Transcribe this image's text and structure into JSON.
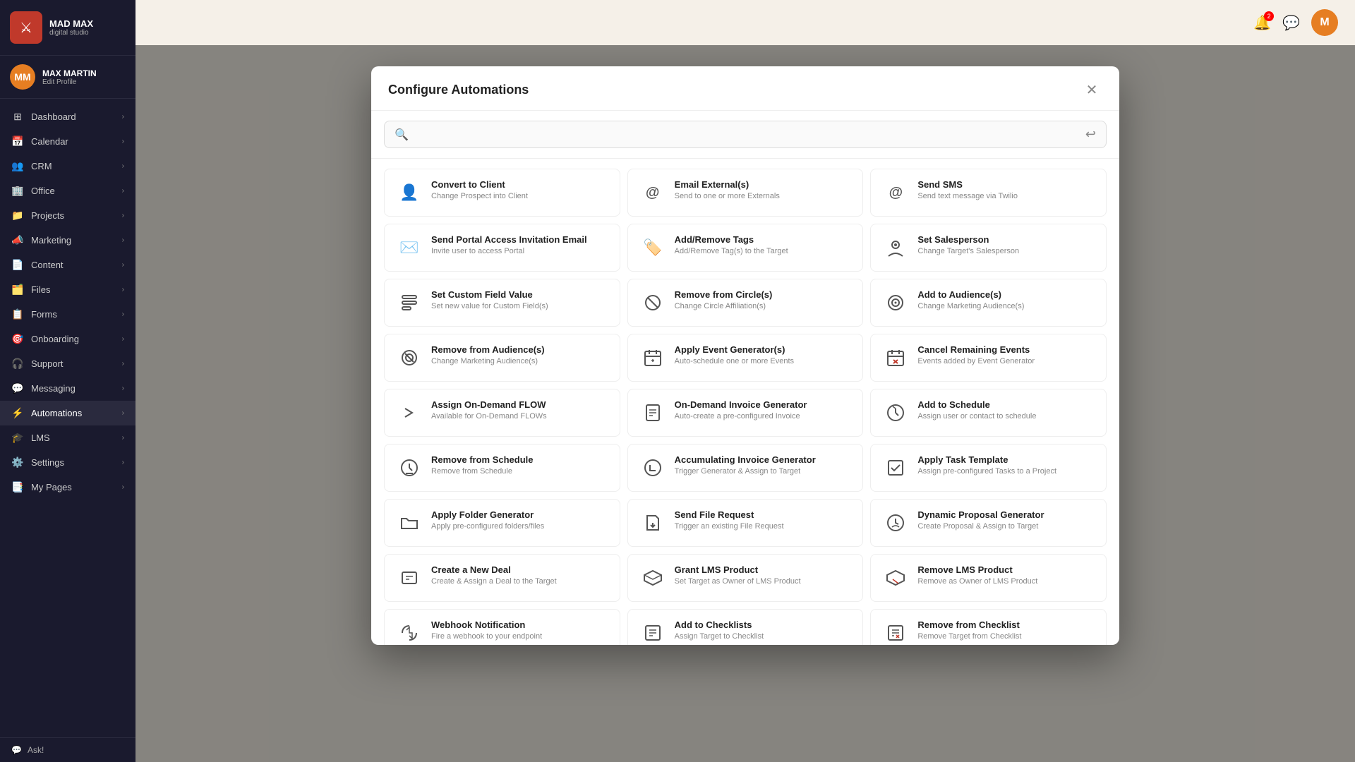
{
  "app": {
    "name": "MAD MAX",
    "subtitle": "digital studio",
    "close_icon": "✕",
    "back_icon": "↩"
  },
  "profile": {
    "name": "MAX MARTIN",
    "edit_label": "Edit Profile",
    "initials": "MM"
  },
  "sidebar": {
    "items": [
      {
        "id": "dashboard",
        "label": "Dashboard",
        "icon": "⊞"
      },
      {
        "id": "calendar",
        "label": "Calendar",
        "icon": "📅"
      },
      {
        "id": "crm",
        "label": "CRM",
        "icon": "👥"
      },
      {
        "id": "office",
        "label": "Office",
        "icon": "🏢"
      },
      {
        "id": "projects",
        "label": "Projects",
        "icon": "📁"
      },
      {
        "id": "marketing",
        "label": "Marketing",
        "icon": "📣"
      },
      {
        "id": "content",
        "label": "Content",
        "icon": "📄"
      },
      {
        "id": "files",
        "label": "Files",
        "icon": "🗂️"
      },
      {
        "id": "forms",
        "label": "Forms",
        "icon": "📋"
      },
      {
        "id": "onboarding",
        "label": "Onboarding",
        "icon": "🎯"
      },
      {
        "id": "support",
        "label": "Support",
        "icon": "🎧"
      },
      {
        "id": "messaging",
        "label": "Messaging",
        "icon": "💬"
      },
      {
        "id": "automations",
        "label": "Automations",
        "icon": "⚡"
      },
      {
        "id": "lms",
        "label": "LMS",
        "icon": "🎓"
      },
      {
        "id": "settings",
        "label": "Settings",
        "icon": "⚙️"
      },
      {
        "id": "my-pages",
        "label": "My Pages",
        "icon": "📑"
      }
    ],
    "ask_label": "Ask!"
  },
  "topbar": {
    "notification_count": "2"
  },
  "modal": {
    "title": "Configure Automations",
    "search_placeholder": "",
    "items": [
      {
        "id": "convert-to-client",
        "title": "Convert to Client",
        "description": "Change Prospect into Client",
        "icon": "👤"
      },
      {
        "id": "email-externals",
        "title": "Email External(s)",
        "description": "Send to one or more Externals",
        "icon": "@"
      },
      {
        "id": "send-sms",
        "title": "Send SMS",
        "description": "Send text message via Twilio",
        "icon": "@"
      },
      {
        "id": "send-portal-access",
        "title": "Send Portal Access Invitation Email",
        "description": "Invite user to access Portal",
        "icon": "✉"
      },
      {
        "id": "add-remove-tags",
        "title": "Add/Remove Tags",
        "description": "Add/Remove Tag(s) to the Target",
        "icon": "🏷"
      },
      {
        "id": "set-salesperson",
        "title": "Set Salesperson",
        "description": "Change Target's Salesperson",
        "icon": "◉"
      },
      {
        "id": "set-custom-field",
        "title": "Set Custom Field Value",
        "description": "Set new value for Custom Field(s)",
        "icon": "⊟"
      },
      {
        "id": "remove-from-circle",
        "title": "Remove from Circle(s)",
        "description": "Change Circle Affiliation(s)",
        "icon": "◌"
      },
      {
        "id": "add-to-audiences",
        "title": "Add to Audience(s)",
        "description": "Change Marketing Audience(s)",
        "icon": "🎯"
      },
      {
        "id": "remove-from-audiences",
        "title": "Remove from Audience(s)",
        "description": "Change Marketing Audience(s)",
        "icon": "🎯"
      },
      {
        "id": "apply-event-generator",
        "title": "Apply Event Generator(s)",
        "description": "Auto-schedule one or more Events",
        "icon": "📅"
      },
      {
        "id": "cancel-remaining-events",
        "title": "Cancel Remaining Events",
        "description": "Events added by Event Generator",
        "icon": "📅"
      },
      {
        "id": "assign-on-demand-flow",
        "title": "Assign On-Demand FLOW",
        "description": "Available for On-Demand FLOWs",
        "icon": "»"
      },
      {
        "id": "on-demand-invoice-generator",
        "title": "On-Demand Invoice Generator",
        "description": "Auto-create a pre-configured Invoice",
        "icon": "📄"
      },
      {
        "id": "add-to-schedule",
        "title": "Add to Schedule",
        "description": "Assign user or contact to schedule",
        "icon": "🕐"
      },
      {
        "id": "remove-from-schedule",
        "title": "Remove from Schedule",
        "description": "Remove from Schedule",
        "icon": "🕐"
      },
      {
        "id": "accumulating-invoice-generator",
        "title": "Accumulating Invoice Generator",
        "description": "Trigger Generator & Assign to Target",
        "icon": "⚙"
      },
      {
        "id": "apply-task-template",
        "title": "Apply Task Template",
        "description": "Assign pre-configured Tasks to a Project",
        "icon": "☑"
      },
      {
        "id": "apply-folder-generator",
        "title": "Apply Folder Generator",
        "description": "Apply pre-configured folders/files",
        "icon": "📂"
      },
      {
        "id": "send-file-request",
        "title": "Send File Request",
        "description": "Trigger an existing File Request",
        "icon": "📎"
      },
      {
        "id": "dynamic-proposal-generator",
        "title": "Dynamic Proposal Generator",
        "description": "Create Proposal & Assign to Target",
        "icon": "⚙"
      },
      {
        "id": "create-new-deal",
        "title": "Create a New Deal",
        "description": "Create & Assign a Deal to the Target",
        "icon": "📋"
      },
      {
        "id": "grant-lms-product",
        "title": "Grant LMS Product",
        "description": "Set Target as Owner of LMS Product",
        "icon": "🎓"
      },
      {
        "id": "remove-lms-product",
        "title": "Remove LMS Product",
        "description": "Remove as Owner of LMS Product",
        "icon": "🎓"
      },
      {
        "id": "webhook-notification",
        "title": "Webhook Notification",
        "description": "Fire a webhook to your endpoint",
        "icon": "↺"
      },
      {
        "id": "add-to-checklists",
        "title": "Add to Checklists",
        "description": "Assign Target to Checklist",
        "icon": "☑"
      },
      {
        "id": "remove-from-checklist",
        "title": "Remove from Checklist",
        "description": "Remove Target from Checklist",
        "icon": "☑"
      }
    ]
  }
}
